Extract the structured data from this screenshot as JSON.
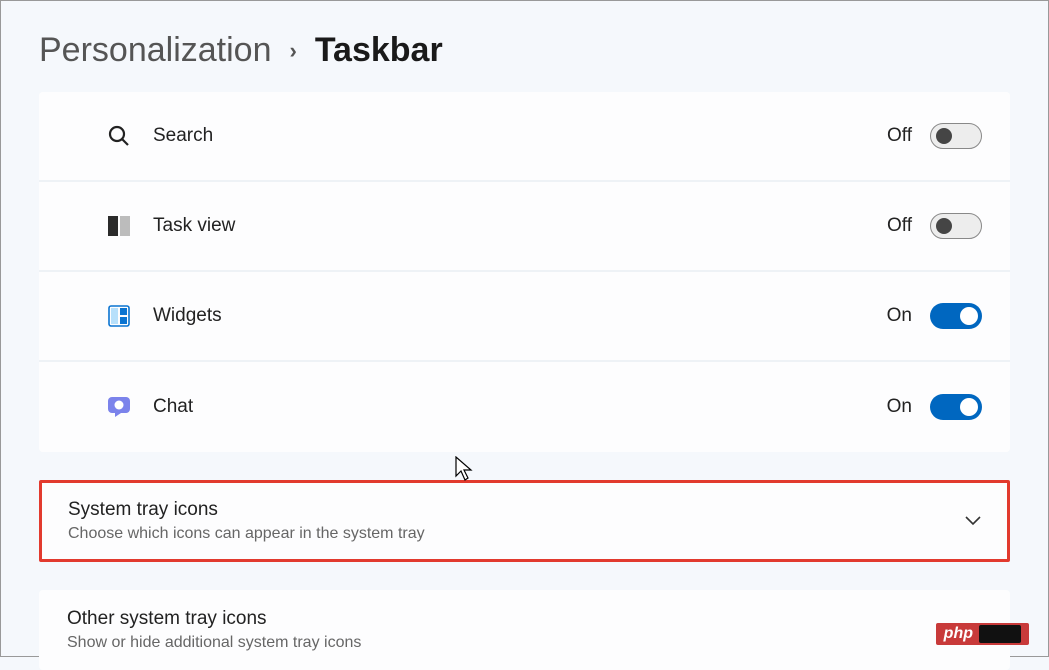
{
  "breadcrumb": {
    "parent": "Personalization",
    "current": "Taskbar"
  },
  "items": [
    {
      "label": "Search",
      "state": "Off",
      "on": false,
      "icon": "search-icon"
    },
    {
      "label": "Task view",
      "state": "Off",
      "on": false,
      "icon": "taskview-icon"
    },
    {
      "label": "Widgets",
      "state": "On",
      "on": true,
      "icon": "widgets-icon"
    },
    {
      "label": "Chat",
      "state": "On",
      "on": true,
      "icon": "chat-icon"
    }
  ],
  "sections": [
    {
      "title": "System tray icons",
      "subtitle": "Choose which icons can appear in the system tray",
      "highlight": true
    },
    {
      "title": "Other system tray icons",
      "subtitle": "Show or hide additional system tray icons",
      "highlight": false
    }
  ],
  "badge": {
    "text": "php"
  }
}
